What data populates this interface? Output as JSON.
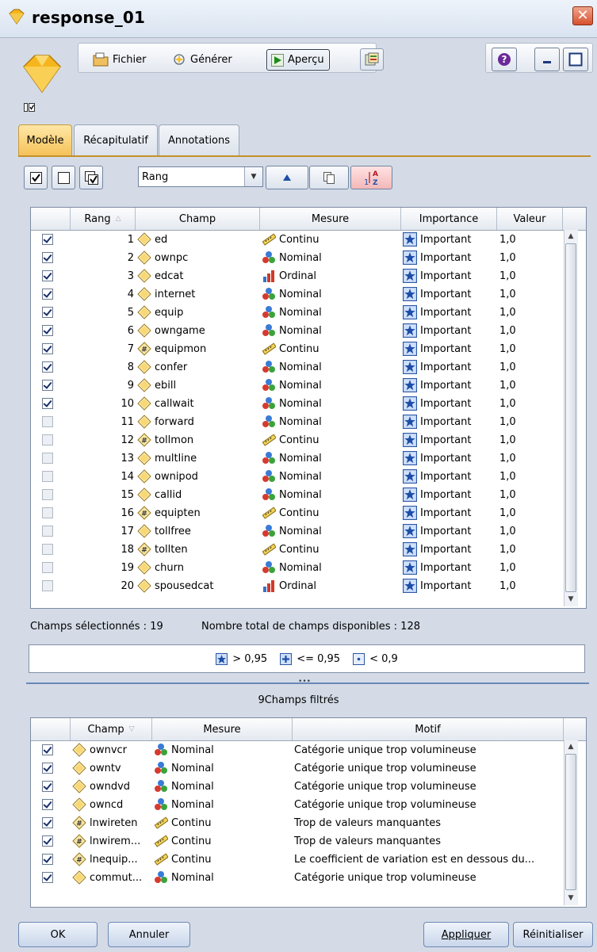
{
  "window": {
    "title": "response_01",
    "close_label": "✕"
  },
  "toolbar": {
    "fichier": "Fichier",
    "generer": "Générer",
    "apercu": "Aperçu",
    "help_icon": "help-icon",
    "minimize_icon": "minimize-icon",
    "maximize_icon": "maximize-icon"
  },
  "tabs": [
    {
      "label": "Modèle",
      "active": true
    },
    {
      "label": "Récapitulatif",
      "active": false
    },
    {
      "label": "Annotations",
      "active": false
    }
  ],
  "filter_toolbar": {
    "sort_value": "Rang"
  },
  "rank_table": {
    "headers": [
      "",
      "Rang",
      "Champ",
      "Mesure",
      "Importance",
      "Valeur"
    ],
    "rows": [
      {
        "checked": true,
        "rang": "1",
        "champ": "ed",
        "field_type": "set",
        "mesure": "Continu",
        "importance": "Important",
        "valeur": "1,0"
      },
      {
        "checked": true,
        "rang": "2",
        "champ": "ownpc",
        "field_type": "set",
        "mesure": "Nominal",
        "importance": "Important",
        "valeur": "1,0"
      },
      {
        "checked": true,
        "rang": "3",
        "champ": "edcat",
        "field_type": "set",
        "mesure": "Ordinal",
        "importance": "Important",
        "valeur": "1,0"
      },
      {
        "checked": true,
        "rang": "4",
        "champ": "internet",
        "field_type": "set",
        "mesure": "Nominal",
        "importance": "Important",
        "valeur": "1,0"
      },
      {
        "checked": true,
        "rang": "5",
        "champ": "equip",
        "field_type": "set",
        "mesure": "Nominal",
        "importance": "Important",
        "valeur": "1,0"
      },
      {
        "checked": true,
        "rang": "6",
        "champ": "owngame",
        "field_type": "set",
        "mesure": "Nominal",
        "importance": "Important",
        "valeur": "1,0"
      },
      {
        "checked": true,
        "rang": "7",
        "champ": "equipmon",
        "field_type": "range",
        "mesure": "Continu",
        "importance": "Important",
        "valeur": "1,0"
      },
      {
        "checked": true,
        "rang": "8",
        "champ": "confer",
        "field_type": "set",
        "mesure": "Nominal",
        "importance": "Important",
        "valeur": "1,0"
      },
      {
        "checked": true,
        "rang": "9",
        "champ": "ebill",
        "field_type": "set",
        "mesure": "Nominal",
        "importance": "Important",
        "valeur": "1,0"
      },
      {
        "checked": true,
        "rang": "10",
        "champ": "callwait",
        "field_type": "set",
        "mesure": "Nominal",
        "importance": "Important",
        "valeur": "1,0"
      },
      {
        "checked": false,
        "rang": "11",
        "champ": "forward",
        "field_type": "set",
        "mesure": "Nominal",
        "importance": "Important",
        "valeur": "1,0"
      },
      {
        "checked": false,
        "rang": "12",
        "champ": "tollmon",
        "field_type": "range",
        "mesure": "Continu",
        "importance": "Important",
        "valeur": "1,0"
      },
      {
        "checked": false,
        "rang": "13",
        "champ": "multline",
        "field_type": "set",
        "mesure": "Nominal",
        "importance": "Important",
        "valeur": "1,0"
      },
      {
        "checked": false,
        "rang": "14",
        "champ": "ownipod",
        "field_type": "set",
        "mesure": "Nominal",
        "importance": "Important",
        "valeur": "1,0"
      },
      {
        "checked": false,
        "rang": "15",
        "champ": "callid",
        "field_type": "set",
        "mesure": "Nominal",
        "importance": "Important",
        "valeur": "1,0"
      },
      {
        "checked": false,
        "rang": "16",
        "champ": "equipten",
        "field_type": "range",
        "mesure": "Continu",
        "importance": "Important",
        "valeur": "1,0"
      },
      {
        "checked": false,
        "rang": "17",
        "champ": "tollfree",
        "field_type": "set",
        "mesure": "Nominal",
        "importance": "Important",
        "valeur": "1,0"
      },
      {
        "checked": false,
        "rang": "18",
        "champ": "tollten",
        "field_type": "range",
        "mesure": "Continu",
        "importance": "Important",
        "valeur": "1,0"
      },
      {
        "checked": false,
        "rang": "19",
        "champ": "churn",
        "field_type": "set",
        "mesure": "Nominal",
        "importance": "Important",
        "valeur": "1,0"
      },
      {
        "checked": false,
        "rang": "20",
        "champ": "spousedcat",
        "field_type": "set",
        "mesure": "Ordinal",
        "importance": "Important",
        "valeur": "1,0"
      }
    ]
  },
  "summary": {
    "selected": "Champs sélectionnés : 19",
    "total": "Nombre total de champs disponibles : 128"
  },
  "legend": [
    {
      "icon": "star-icon",
      "label": "> 0,95"
    },
    {
      "icon": "plus-icon",
      "label": "<= 0,95"
    },
    {
      "icon": "dot-icon",
      "label": "< 0,9"
    }
  ],
  "filtered_title": "9Champs filtrés",
  "filtered_table": {
    "headers": [
      "",
      "Champ",
      "Mesure",
      "Motif"
    ],
    "rows": [
      {
        "checked": true,
        "champ": "ownvcr",
        "field_type": "set",
        "mesure": "Nominal",
        "motif": "Catégorie unique trop volumineuse"
      },
      {
        "checked": true,
        "champ": "owntv",
        "field_type": "set",
        "mesure": "Nominal",
        "motif": "Catégorie unique trop volumineuse"
      },
      {
        "checked": true,
        "champ": "owndvd",
        "field_type": "set",
        "mesure": "Nominal",
        "motif": "Catégorie unique trop volumineuse"
      },
      {
        "checked": true,
        "champ": "owncd",
        "field_type": "set",
        "mesure": "Nominal",
        "motif": "Catégorie unique trop volumineuse"
      },
      {
        "checked": true,
        "champ": "lnwireten",
        "field_type": "range",
        "mesure": "Continu",
        "motif": "Trop de valeurs manquantes"
      },
      {
        "checked": true,
        "champ": "lnwirem...",
        "field_type": "range",
        "mesure": "Continu",
        "motif": "Trop de valeurs manquantes"
      },
      {
        "checked": true,
        "champ": "lnequip...",
        "field_type": "range",
        "mesure": "Continu",
        "motif": "Le coefficient de variation est en dessous du..."
      },
      {
        "checked": true,
        "champ": "commut...",
        "field_type": "set",
        "mesure": "Nominal",
        "motif": "Catégorie unique trop volumineuse"
      }
    ]
  },
  "buttons": {
    "ok": "OK",
    "cancel": "Annuler",
    "apply": "Appliquer",
    "reset": "Réinitialiser"
  },
  "colors": {
    "accent_tab": "#f5c25a",
    "star_blue": "#2b57a5",
    "title_close": "#d6512e"
  }
}
